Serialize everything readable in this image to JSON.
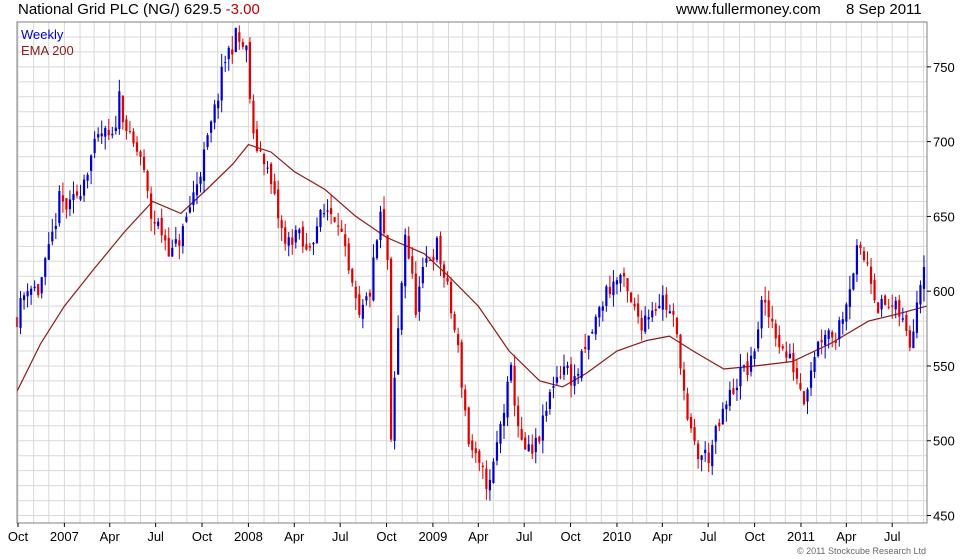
{
  "header": {
    "instrument": "National Grid PLC (NG/)",
    "last_price": "629.5",
    "change": "-3.00",
    "site": "www.fullermoney.com",
    "date": "8 Sep 2011"
  },
  "copyright": "© 2011 Stockcube Research Ltd",
  "colors": {
    "up_candle": "#0000cc",
    "down_candle": "#e00000",
    "ema_line": "#8b1a1a",
    "grid": "#d8d8d8",
    "frame": "#808080"
  },
  "chart_data": {
    "type": "line",
    "subtype": "candlestick",
    "ylim": [
      445,
      780
    ],
    "y_ticks": [
      450,
      500,
      550,
      600,
      650,
      700,
      750
    ],
    "y_axis_side": "right",
    "x_range": [
      "2006-09-29",
      "2011-09-08"
    ],
    "grid": true,
    "legend_position": "top-left",
    "x_ticks": [
      {
        "label": "Oct",
        "date": "2006-10-01"
      },
      {
        "label": "2007",
        "date": "2007-01-01"
      },
      {
        "label": "Apr",
        "date": "2007-04-01"
      },
      {
        "label": "Jul",
        "date": "2007-07-01"
      },
      {
        "label": "Oct",
        "date": "2007-10-01"
      },
      {
        "label": "2008",
        "date": "2008-01-01"
      },
      {
        "label": "Apr",
        "date": "2008-04-01"
      },
      {
        "label": "Jul",
        "date": "2008-07-01"
      },
      {
        "label": "Oct",
        "date": "2008-10-01"
      },
      {
        "label": "2009",
        "date": "2009-01-01"
      },
      {
        "label": "Apr",
        "date": "2009-04-01"
      },
      {
        "label": "Jul",
        "date": "2009-07-01"
      },
      {
        "label": "Oct",
        "date": "2009-10-01"
      },
      {
        "label": "2010",
        "date": "2010-01-01"
      },
      {
        "label": "Apr",
        "date": "2010-04-01"
      },
      {
        "label": "Jul",
        "date": "2010-07-01"
      },
      {
        "label": "Oct",
        "date": "2010-10-01"
      },
      {
        "label": "2011",
        "date": "2011-01-01"
      },
      {
        "label": "Apr",
        "date": "2011-04-01"
      },
      {
        "label": "Jul",
        "date": "2011-07-01"
      }
    ],
    "series": [
      {
        "name": "Weekly",
        "kind": "close",
        "points": [
          [
            "2006-09-29",
            583
          ],
          [
            "2006-10-20",
            605
          ],
          [
            "2006-11-10",
            600
          ],
          [
            "2006-12-01",
            625
          ],
          [
            "2006-12-22",
            660
          ],
          [
            "2007-01-12",
            655
          ],
          [
            "2007-02-02",
            670
          ],
          [
            "2007-02-23",
            690
          ],
          [
            "2007-03-16",
            705
          ],
          [
            "2007-04-06",
            700
          ],
          [
            "2007-04-20",
            730
          ],
          [
            "2007-05-11",
            700
          ],
          [
            "2007-06-01",
            690
          ],
          [
            "2007-06-22",
            650
          ],
          [
            "2007-07-13",
            640
          ],
          [
            "2007-08-03",
            625
          ],
          [
            "2007-08-24",
            640
          ],
          [
            "2007-09-14",
            665
          ],
          [
            "2007-10-05",
            690
          ],
          [
            "2007-10-26",
            720
          ],
          [
            "2007-11-16",
            755
          ],
          [
            "2007-12-07",
            770
          ],
          [
            "2007-12-28",
            760
          ],
          [
            "2008-01-11",
            700
          ],
          [
            "2008-02-01",
            690
          ],
          [
            "2008-02-22",
            660
          ],
          [
            "2008-03-14",
            630
          ],
          [
            "2008-04-04",
            640
          ],
          [
            "2008-04-25",
            625
          ],
          [
            "2008-05-16",
            645
          ],
          [
            "2008-06-06",
            655
          ],
          [
            "2008-06-27",
            650
          ],
          [
            "2008-07-18",
            610
          ],
          [
            "2008-08-08",
            580
          ],
          [
            "2008-08-29",
            600
          ],
          [
            "2008-09-19",
            650
          ],
          [
            "2008-10-03",
            620
          ],
          [
            "2008-10-10",
            495
          ],
          [
            "2008-10-17",
            540
          ],
          [
            "2008-11-07",
            640
          ],
          [
            "2008-11-28",
            590
          ],
          [
            "2008-12-19",
            620
          ],
          [
            "2009-01-09",
            630
          ],
          [
            "2009-01-30",
            600
          ],
          [
            "2009-02-20",
            560
          ],
          [
            "2009-03-13",
            500
          ],
          [
            "2009-04-03",
            480
          ],
          [
            "2009-04-24",
            470
          ],
          [
            "2009-05-15",
            510
          ],
          [
            "2009-06-05",
            545
          ],
          [
            "2009-06-26",
            495
          ],
          [
            "2009-07-17",
            490
          ],
          [
            "2009-08-07",
            510
          ],
          [
            "2009-08-28",
            540
          ],
          [
            "2009-09-18",
            550
          ],
          [
            "2009-10-09",
            540
          ],
          [
            "2009-10-30",
            560
          ],
          [
            "2009-11-20",
            580
          ],
          [
            "2009-12-11",
            600
          ],
          [
            "2010-01-08",
            610
          ],
          [
            "2010-01-29",
            590
          ],
          [
            "2010-02-19",
            580
          ],
          [
            "2010-03-12",
            590
          ],
          [
            "2010-04-02",
            595
          ],
          [
            "2010-04-23",
            580
          ],
          [
            "2010-05-07",
            555
          ],
          [
            "2010-05-21",
            510
          ],
          [
            "2010-06-11",
            490
          ],
          [
            "2010-07-02",
            490
          ],
          [
            "2010-07-23",
            510
          ],
          [
            "2010-08-13",
            530
          ],
          [
            "2010-09-03",
            545
          ],
          [
            "2010-09-24",
            550
          ],
          [
            "2010-10-15",
            590
          ],
          [
            "2010-11-05",
            580
          ],
          [
            "2010-11-26",
            560
          ],
          [
            "2010-12-17",
            550
          ],
          [
            "2011-01-07",
            530
          ],
          [
            "2011-01-28",
            560
          ],
          [
            "2011-02-18",
            575
          ],
          [
            "2011-03-11",
            570
          ],
          [
            "2011-04-01",
            595
          ],
          [
            "2011-04-22",
            625
          ],
          [
            "2011-05-13",
            620
          ],
          [
            "2011-06-03",
            590
          ],
          [
            "2011-06-24",
            590
          ],
          [
            "2011-07-15",
            585
          ],
          [
            "2011-08-05",
            565
          ],
          [
            "2011-08-26",
            610
          ],
          [
            "2011-09-08",
            629.5
          ]
        ]
      },
      {
        "name": "EMA 200",
        "kind": "line",
        "points": [
          [
            "2006-09-29",
            533
          ],
          [
            "2006-11-15",
            565
          ],
          [
            "2007-01-01",
            590
          ],
          [
            "2007-03-01",
            615
          ],
          [
            "2007-05-01",
            640
          ],
          [
            "2007-06-25",
            660
          ],
          [
            "2007-08-20",
            652
          ],
          [
            "2007-10-10",
            668
          ],
          [
            "2007-12-01",
            685
          ],
          [
            "2008-01-01",
            698
          ],
          [
            "2008-02-15",
            693
          ],
          [
            "2008-04-01",
            680
          ],
          [
            "2008-06-01",
            668
          ],
          [
            "2008-08-01",
            650
          ],
          [
            "2008-10-01",
            636
          ],
          [
            "2008-12-15",
            625
          ],
          [
            "2009-02-01",
            610
          ],
          [
            "2009-04-01",
            590
          ],
          [
            "2009-06-01",
            560
          ],
          [
            "2009-08-01",
            540
          ],
          [
            "2009-09-15",
            536
          ],
          [
            "2009-11-01",
            545
          ],
          [
            "2010-01-01",
            560
          ],
          [
            "2010-03-01",
            567
          ],
          [
            "2010-04-15",
            570
          ],
          [
            "2010-06-01",
            560
          ],
          [
            "2010-08-01",
            548
          ],
          [
            "2010-10-01",
            550
          ],
          [
            "2010-12-15",
            553
          ],
          [
            "2011-03-01",
            565
          ],
          [
            "2011-05-15",
            580
          ],
          [
            "2011-07-15",
            585
          ],
          [
            "2011-09-08",
            590
          ]
        ]
      }
    ]
  }
}
